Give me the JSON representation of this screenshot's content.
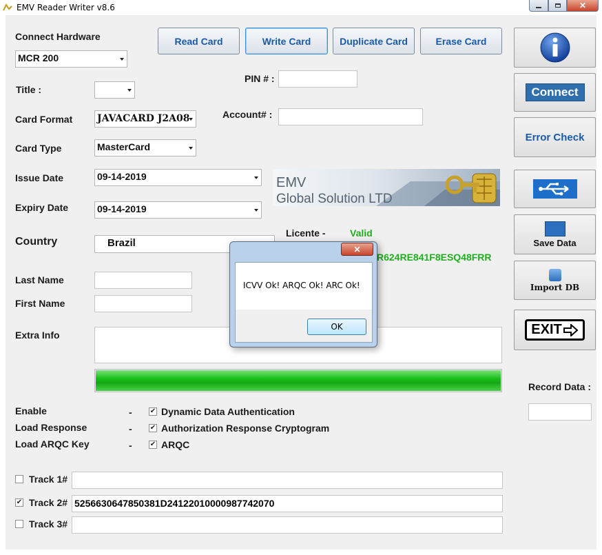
{
  "window": {
    "title": "EMV Reader Writer v8.6"
  },
  "toolbar": {
    "read_card": "Read Card",
    "write_card": "Write Card",
    "duplicate_card": "Duplicate Card",
    "erase_card": "Erase Card"
  },
  "form": {
    "connect_hardware_label": "Connect Hardware",
    "hardware_value": "MCR 200",
    "title_label": "Title :",
    "title_value": "",
    "card_format_label": "Card Format",
    "card_format_value": "JAVACARD J2A08",
    "card_type_label": "Card Type",
    "card_type_value": "MasterCard",
    "issue_date_label": "Issue Date",
    "issue_date_value": "09-14-2019",
    "expiry_date_label": "Expiry Date",
    "expiry_date_value": "09-14-2019",
    "country_label": "Country",
    "country_value": "Brazil",
    "last_name_label": "Last Name",
    "last_name_value": "",
    "first_name_label": "First Name",
    "first_name_value": "",
    "extra_info_label": "Extra Info",
    "extra_info_value": "",
    "pin_label": "PIN # :",
    "pin_value": "",
    "account_label": "Account# :",
    "account_value": ""
  },
  "banner": {
    "line1": "EMV",
    "line2": "Global Solution LTD"
  },
  "license": {
    "label": "Licente -",
    "status": "Valid",
    "key_visible": "R624RE841F8ESQ48FRR",
    "status_color": "#1fae1f"
  },
  "progress": {
    "fraction": 1.0,
    "color": "#1ec21e"
  },
  "options": {
    "enable_label": "Enable",
    "load_response_label": "Load Response",
    "load_arqc_key_label": "Load ARQC Key",
    "dash": "-",
    "dda_label": "Dynamic Data Authentication",
    "arc_label": "Authorization Response Cryptogram",
    "arqc_label": "ARQC",
    "dda_checked": true,
    "arc_checked": true,
    "arqc_checked": true
  },
  "tracks": {
    "track1_label": "Track 1#",
    "track1_value": "",
    "track1_checked": false,
    "track2_label": "Track 2#",
    "track2_value": "5256630647850381D24122010000987742070",
    "track2_checked": true,
    "track3_label": "Track 3#",
    "track3_value": "",
    "track3_checked": false
  },
  "side": {
    "info_icon": "info-icon",
    "connect": "Connect",
    "error_check": "Error Check",
    "usb_icon": "usb-icon",
    "save_data": "Save Data",
    "import_db": "Import DB",
    "exit": "EXIT",
    "record_data_label": "Record Data :",
    "record_data_value": ""
  },
  "dialog": {
    "message": "ICVV Ok! ARQC Ok! ARC Ok!",
    "ok": "OK"
  },
  "colors": {
    "accent_blue": "#1a5aa8",
    "connect_bg": "#2f6fae",
    "close_red": "#c8442c"
  }
}
